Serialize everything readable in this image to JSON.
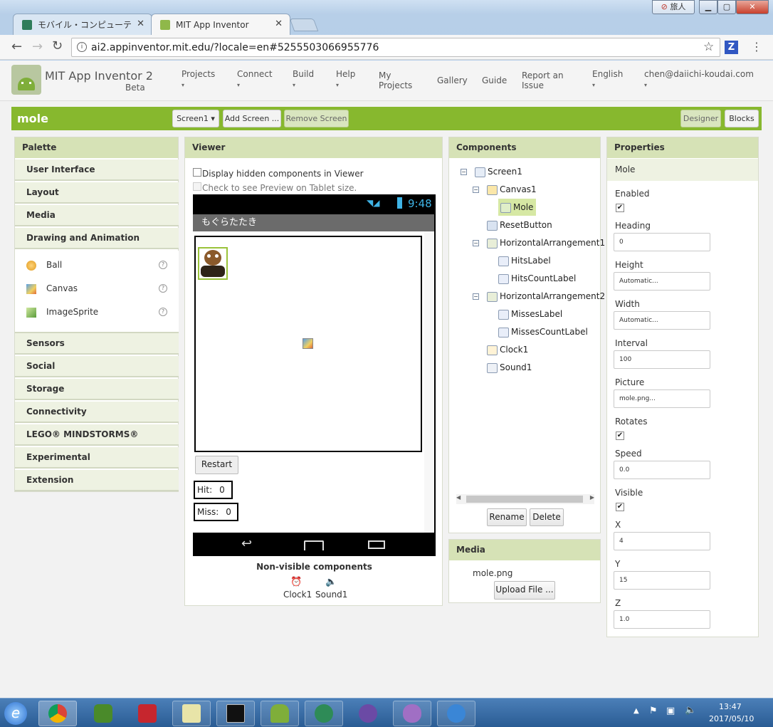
{
  "browser": {
    "tabs": [
      {
        "label": "モバイル・コンピューテ"
      },
      {
        "label": "MIT App Inventor"
      }
    ],
    "url": "ai2.appinventor.mit.edu/?locale=en#5255503066955776",
    "window_user_label": "旅人"
  },
  "header": {
    "brand": "MIT App Inventor 2",
    "beta": "Beta",
    "nav": [
      {
        "label": "Projects",
        "dropdown": true
      },
      {
        "label": "Connect",
        "dropdown": true
      },
      {
        "label": "Build",
        "dropdown": true
      },
      {
        "label": "Help",
        "dropdown": true
      },
      {
        "label": "My Projects"
      },
      {
        "label": "Gallery"
      },
      {
        "label": "Guide"
      },
      {
        "label": "Report an Issue"
      },
      {
        "label": "English",
        "dropdown": true
      },
      {
        "label": "chen@daiichi-koudai.com",
        "dropdown": true
      }
    ]
  },
  "project": {
    "name": "mole",
    "screen_select": "Screen1 ▾",
    "add_screen": "Add Screen ...",
    "remove_screen": "Remove Screen",
    "designer": "Designer",
    "blocks": "Blocks"
  },
  "palette": {
    "title": "Palette",
    "categories_top": [
      "User Interface",
      "Layout",
      "Media",
      "Drawing and Animation"
    ],
    "items": [
      {
        "label": "Ball",
        "icon": "ball-icon"
      },
      {
        "label": "Canvas",
        "icon": "canvas-icon"
      },
      {
        "label": "ImageSprite",
        "icon": "imagesprite-icon"
      }
    ],
    "categories_bottom": [
      "Sensors",
      "Social",
      "Storage",
      "Connectivity",
      "LEGO® MINDSTORMS®",
      "Experimental",
      "Extension"
    ]
  },
  "viewer": {
    "title": "Viewer",
    "checkbox_hidden": "Display hidden components in Viewer",
    "checkbox_tablet": "Check to see Preview on Tablet size.",
    "phone_time": "9:48",
    "app_title": "もぐらたたき",
    "restart": "Restart",
    "hit_label": "Hit:",
    "hit_count": "0",
    "miss_label": "Miss:",
    "miss_count": "0",
    "nonvisible_title": "Non-visible components",
    "nonvisible": [
      {
        "label": "Clock1",
        "icon": "clock-icon"
      },
      {
        "label": "Sound1",
        "icon": "sound-icon"
      }
    ]
  },
  "components": {
    "title": "Components",
    "tree": [
      {
        "label": "Screen1",
        "depth": 0,
        "toggle": "⊟"
      },
      {
        "label": "Canvas1",
        "depth": 1,
        "toggle": "⊟"
      },
      {
        "label": "Mole",
        "depth": 2,
        "selected": true
      },
      {
        "label": "ResetButton",
        "depth": 1
      },
      {
        "label": "HorizontalArrangement1",
        "depth": 1,
        "toggle": "⊟"
      },
      {
        "label": "HitsLabel",
        "depth": 2
      },
      {
        "label": "HitsCountLabel",
        "depth": 2
      },
      {
        "label": "HorizontalArrangement2",
        "depth": 1,
        "toggle": "⊟"
      },
      {
        "label": "MissesLabel",
        "depth": 2
      },
      {
        "label": "MissesCountLabel",
        "depth": 2
      },
      {
        "label": "Clock1",
        "depth": 1
      },
      {
        "label": "Sound1",
        "depth": 1
      }
    ],
    "rename": "Rename",
    "delete": "Delete"
  },
  "media": {
    "title": "Media",
    "file": "mole.png",
    "upload": "Upload File ..."
  },
  "properties": {
    "title": "Properties",
    "component": "Mole",
    "fields": [
      {
        "label": "Enabled",
        "type": "checkbox",
        "checked": true
      },
      {
        "label": "Heading",
        "type": "text",
        "value": "0"
      },
      {
        "label": "Height",
        "type": "text",
        "value": "Automatic..."
      },
      {
        "label": "Width",
        "type": "text",
        "value": "Automatic..."
      },
      {
        "label": "Interval",
        "type": "text",
        "value": "100"
      },
      {
        "label": "Picture",
        "type": "text",
        "value": "mole.png..."
      },
      {
        "label": "Rotates",
        "type": "checkbox",
        "checked": true
      },
      {
        "label": "Speed",
        "type": "text",
        "value": "0.0"
      },
      {
        "label": "Visible",
        "type": "checkbox",
        "checked": true
      },
      {
        "label": "X",
        "type": "text",
        "value": "4"
      },
      {
        "label": "Y",
        "type": "text",
        "value": "15"
      },
      {
        "label": "Z",
        "type": "text",
        "value": "1.0"
      }
    ]
  },
  "taskbar": {
    "time": "13:47",
    "date": "2017/05/10"
  },
  "colors": {
    "green": "#87b82e",
    "panel_header": "#d6e2b6"
  }
}
